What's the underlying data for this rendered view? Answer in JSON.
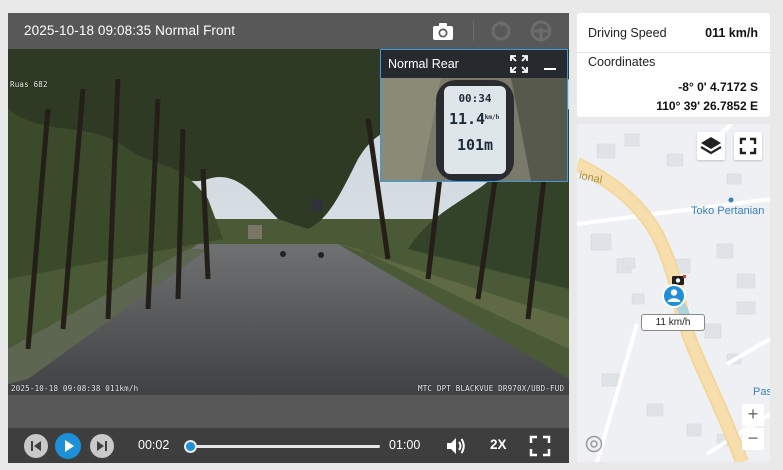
{
  "player": {
    "title": "2025-10-18 09:08:35 Normal Front",
    "toolbar_icons": [
      "camera-icon",
      "rotate-icon",
      "steering-wheel-icon"
    ],
    "osd_topleft": "Ruas 682",
    "osd_timestamp": "2025-10-18 09:08:38 011km/h",
    "osd_brand": "MTC DPT BLACKVUE DR970X/UBD-FUD",
    "controls": {
      "time_current": "00:02",
      "time_total": "01:00",
      "progress": 0.033,
      "speed": "2X",
      "icons": [
        "previous-icon",
        "play-icon",
        "next-icon",
        "volume-icon",
        "fullscreen-icon"
      ]
    }
  },
  "rear": {
    "title": "Normal Rear",
    "gps_readout": [
      "00:34",
      "11.4",
      "km/h",
      "101m"
    ]
  },
  "info": {
    "speed_label": "Driving Speed",
    "speed_value": "011 km/h",
    "coords_label": "Coordinates",
    "latitude": "-8° 0' 4.7172 S",
    "longitude": "110° 39' 26.7852 E"
  },
  "map": {
    "poi_label": "Toko Pertanian",
    "road_label": "ional",
    "edge_label": "Pas",
    "speed_tag": "11 km/h",
    "zoom_in": "+",
    "zoom_out": "−",
    "icons": [
      "layers-icon",
      "fullscreen-icon",
      "vehicle-marker-icon",
      "camera-marker-icon",
      "map-logo-icon"
    ],
    "colors": {
      "road": "#f3d79e",
      "marker": "#1f8fd6"
    }
  }
}
